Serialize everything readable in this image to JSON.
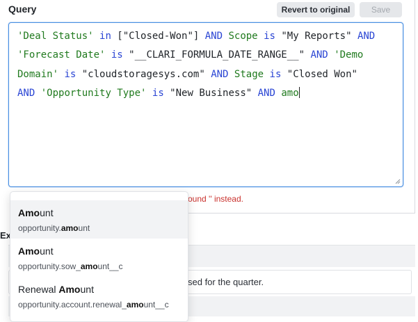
{
  "query": {
    "label": "Query",
    "revert_label": "Revert to original",
    "save_label": "Save",
    "code_lines": [
      [
        {
          "t": "'Deal Status'",
          "c": "s"
        },
        {
          "t": " ",
          "c": "p"
        },
        {
          "t": "in",
          "c": "k"
        },
        {
          "t": " [\"Closed-Won\"] ",
          "c": "p"
        },
        {
          "t": "AND",
          "c": "k"
        },
        {
          "t": " ",
          "c": "p"
        },
        {
          "t": "Scope",
          "c": "s"
        },
        {
          "t": " ",
          "c": "p"
        },
        {
          "t": "is",
          "c": "k"
        },
        {
          "t": " \"My Reports\" ",
          "c": "p"
        },
        {
          "t": "AND",
          "c": "k"
        }
      ],
      [
        {
          "t": "'Forecast Date'",
          "c": "s"
        },
        {
          "t": " ",
          "c": "p"
        },
        {
          "t": "is",
          "c": "k"
        },
        {
          "t": " \"__CLARI_FORMULA_DATE_RANGE__\" ",
          "c": "p"
        },
        {
          "t": "AND",
          "c": "k"
        },
        {
          "t": " ",
          "c": "p"
        },
        {
          "t": "'Demo",
          "c": "s"
        }
      ],
      [
        {
          "t": "Domain'",
          "c": "s"
        },
        {
          "t": " ",
          "c": "p"
        },
        {
          "t": "is",
          "c": "k"
        },
        {
          "t": " \"cloudstoragesys.com\" ",
          "c": "p"
        },
        {
          "t": "AND",
          "c": "k"
        },
        {
          "t": " ",
          "c": "p"
        },
        {
          "t": "Stage",
          "c": "s"
        },
        {
          "t": " ",
          "c": "p"
        },
        {
          "t": "is",
          "c": "k"
        },
        {
          "t": " \"Closed Won\"",
          "c": "p"
        }
      ],
      [
        {
          "t": "AND",
          "c": "k"
        },
        {
          "t": " ",
          "c": "p"
        },
        {
          "t": "'Opportunity Type'",
          "c": "s"
        },
        {
          "t": " ",
          "c": "p"
        },
        {
          "t": "is",
          "c": "k"
        },
        {
          "t": " \"New Business\" ",
          "c": "p"
        },
        {
          "t": "AND",
          "c": "k"
        },
        {
          "t": " ",
          "c": "p"
        },
        {
          "t": "amo",
          "c": "s"
        }
      ]
    ],
    "error_fragment": "ound '' instead."
  },
  "background": {
    "examples_label_fragment": "Ex",
    "card_text_fragment": "sed for the quarter."
  },
  "autocomplete": {
    "items": [
      {
        "title_bold": "Amo",
        "title_rest": "unt",
        "path_pre": "opportunity.",
        "path_bold": "amo",
        "path_post": "unt",
        "active": true
      },
      {
        "title_bold": "Amo",
        "title_rest": "unt",
        "path_pre": "opportunity.sow_",
        "path_bold": "amo",
        "path_post": "unt__c",
        "active": false
      },
      {
        "title_pre": "Renewal ",
        "title_bold": "Amo",
        "title_rest": "unt",
        "path_pre": "opportunity.account.renewal_",
        "path_bold": "amo",
        "path_post": "unt__c",
        "active": false
      }
    ]
  },
  "colors": {
    "keyword": "#2a45d4",
    "string_field": "#207a1e",
    "error": "#c9302c",
    "focus_border": "#4a90e2"
  }
}
